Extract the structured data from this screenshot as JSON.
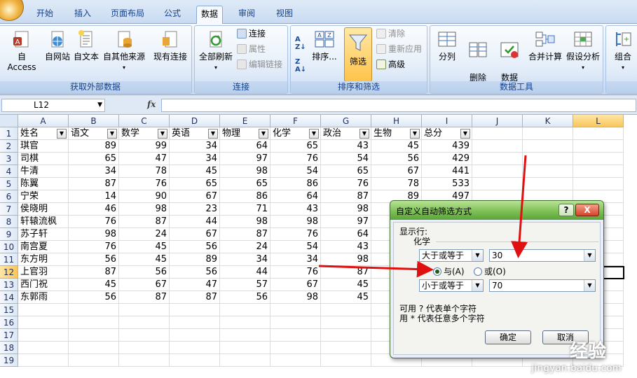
{
  "tabs": [
    "开始",
    "插入",
    "页面布局",
    "公式",
    "数据",
    "审阅",
    "视图"
  ],
  "active_tab": "数据",
  "ribbon": {
    "external_data": {
      "label": "获取外部数据",
      "buttons": [
        "自 Access",
        "自网站",
        "自文本",
        "自其他来源",
        "现有连接"
      ]
    },
    "connections": {
      "label": "连接",
      "refresh_all": "全部刷新",
      "items": [
        "连接",
        "属性",
        "编辑链接"
      ]
    },
    "sort_filter": {
      "label": "排序和筛选",
      "sort": "排序...",
      "filter": "筛选",
      "items": [
        "清除",
        "重新应用",
        "高级"
      ]
    },
    "data_tools": {
      "label": "数据工具",
      "buttons": [
        "分列",
        "删除\n重复项",
        "数据\n有效性",
        "合并计算",
        "假设分析"
      ]
    },
    "outline": {
      "group_btn": "组合"
    }
  },
  "formula_bar": {
    "name_box": "L12",
    "fx": "fx",
    "formula": ""
  },
  "columns": [
    "A",
    "B",
    "C",
    "D",
    "E",
    "F",
    "G",
    "H",
    "I",
    "J",
    "K",
    "L"
  ],
  "selected_column": "L",
  "row_numbers": [
    "1",
    "2",
    "3",
    "4",
    "5",
    "6",
    "7",
    "8",
    "9",
    "10",
    "11",
    "12",
    "13",
    "14",
    "15",
    "16",
    "17",
    "18",
    "19"
  ],
  "selected_row": "12",
  "headers": [
    "姓名",
    "语文",
    "数学",
    "英语",
    "物理",
    "化学",
    "政治",
    "生物",
    "总分"
  ],
  "rows": [
    [
      "琪官",
      "89",
      "99",
      "34",
      "64",
      "65",
      "43",
      "45",
      "439"
    ],
    [
      "司棋",
      "65",
      "47",
      "34",
      "97",
      "76",
      "54",
      "56",
      "429"
    ],
    [
      "牛清",
      "34",
      "78",
      "45",
      "98",
      "54",
      "65",
      "67",
      "441"
    ],
    [
      "陈翼",
      "87",
      "76",
      "65",
      "65",
      "86",
      "76",
      "78",
      "533"
    ],
    [
      "宁荣",
      "14",
      "90",
      "67",
      "86",
      "64",
      "87",
      "89",
      "497"
    ],
    [
      "侯晓明",
      "46",
      "98",
      "23",
      "71",
      "43",
      "98",
      "",
      ""
    ],
    [
      "轩辕流枫",
      "76",
      "87",
      "44",
      "98",
      "98",
      "97",
      "",
      ""
    ],
    [
      "苏子轩",
      "98",
      "24",
      "67",
      "87",
      "76",
      "64",
      "",
      ""
    ],
    [
      "南宫夏",
      "76",
      "45",
      "56",
      "24",
      "54",
      "43",
      "",
      ""
    ],
    [
      "东方明",
      "56",
      "45",
      "89",
      "34",
      "34",
      "98",
      "",
      ""
    ],
    [
      "上官羽",
      "87",
      "56",
      "56",
      "44",
      "76",
      "87",
      "",
      ""
    ],
    [
      "西门祝",
      "45",
      "67",
      "47",
      "57",
      "67",
      "45",
      "",
      ""
    ],
    [
      "东郭雨",
      "56",
      "87",
      "87",
      "56",
      "98",
      "45",
      "",
      ""
    ]
  ],
  "dialog": {
    "title": "自定义自动筛选方式",
    "help": "?",
    "close": "X",
    "show_rows": "显示行:",
    "field": "化学",
    "op1": "大于或等于",
    "val1": "30",
    "and_label": "与(A)",
    "or_label": "或(O)",
    "logic_selected": "and",
    "op2": "小于或等于",
    "val2": "70",
    "hint1": "可用 ? 代表单个字符",
    "hint2": "用 * 代表任意多个字符",
    "ok": "确定",
    "cancel": "取消"
  },
  "watermark": "jingyan.baidu.com",
  "watermark_logo": "经验"
}
